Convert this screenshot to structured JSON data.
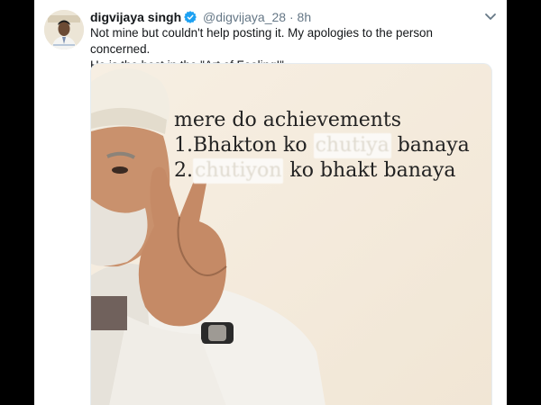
{
  "tweet": {
    "author_name": "digvijaya singh",
    "handle": "@digvijaya_28",
    "separator": "·",
    "time": "8h",
    "text_line1": "Not mine but couldn't help posting it. My apologies to the person concerned.",
    "text_line2": "He is the best in the \"Art of Fooling!\""
  },
  "meme": {
    "line1": "mere do achievements",
    "line2_prefix": "1.Bhakton ko",
    "line2_blurred": "chutiya",
    "line2_suffix": "banaya",
    "line3_prefix": "2.",
    "line3_blurred": "chutiyon",
    "line3_suffix": "ko bhakt banaya"
  },
  "icons": {
    "verified": "verified-badge-icon",
    "menu": "chevron-down-icon"
  },
  "colors": {
    "link_blue": "#1da1f2",
    "text": "#14171a",
    "muted": "#657786",
    "meme_background": "#f5ede0"
  }
}
